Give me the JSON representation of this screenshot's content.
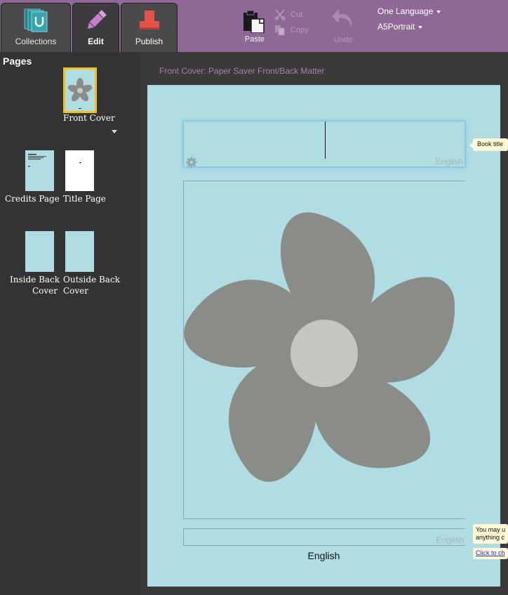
{
  "toolbar": {
    "tabs": [
      {
        "label": "Collections",
        "icon": "collections-icon"
      },
      {
        "label": "Edit",
        "icon": "pencil-icon"
      },
      {
        "label": "Publish",
        "icon": "publish-icon"
      }
    ],
    "paste_label": "Paste",
    "cut_label": "Cut",
    "copy_label": "Copy",
    "undo_label": "Undo",
    "language_dropdown": "One Language",
    "size_dropdown": "A5Portrait",
    "colors": {
      "toolbar_bg": "#8e6996",
      "disabled_text": "#b49db9"
    }
  },
  "pages_panel": {
    "title": "Pages",
    "pages": [
      {
        "caption": "Front Cover",
        "selected": true
      },
      {
        "caption": "Credits Page"
      },
      {
        "caption": "Title Page"
      },
      {
        "caption_line1": "Inside Back",
        "caption_line2": "Cover"
      },
      {
        "caption_line1": "Outside Back",
        "caption_line2": "Cover"
      }
    ],
    "selection_color": "#f2c01c"
  },
  "editor": {
    "breadcrumb": "Front Cover: Paper Saver Front/Back Matter",
    "title_field_lang": "English",
    "credits_field_lang": "English",
    "footer_language": "English",
    "page_color": "#b0dde3"
  },
  "bubbles": {
    "title_hint": "Book title",
    "credits_hint_line1": "You may u",
    "credits_hint_line2": "anything c",
    "credits_link": "Click to ch"
  }
}
